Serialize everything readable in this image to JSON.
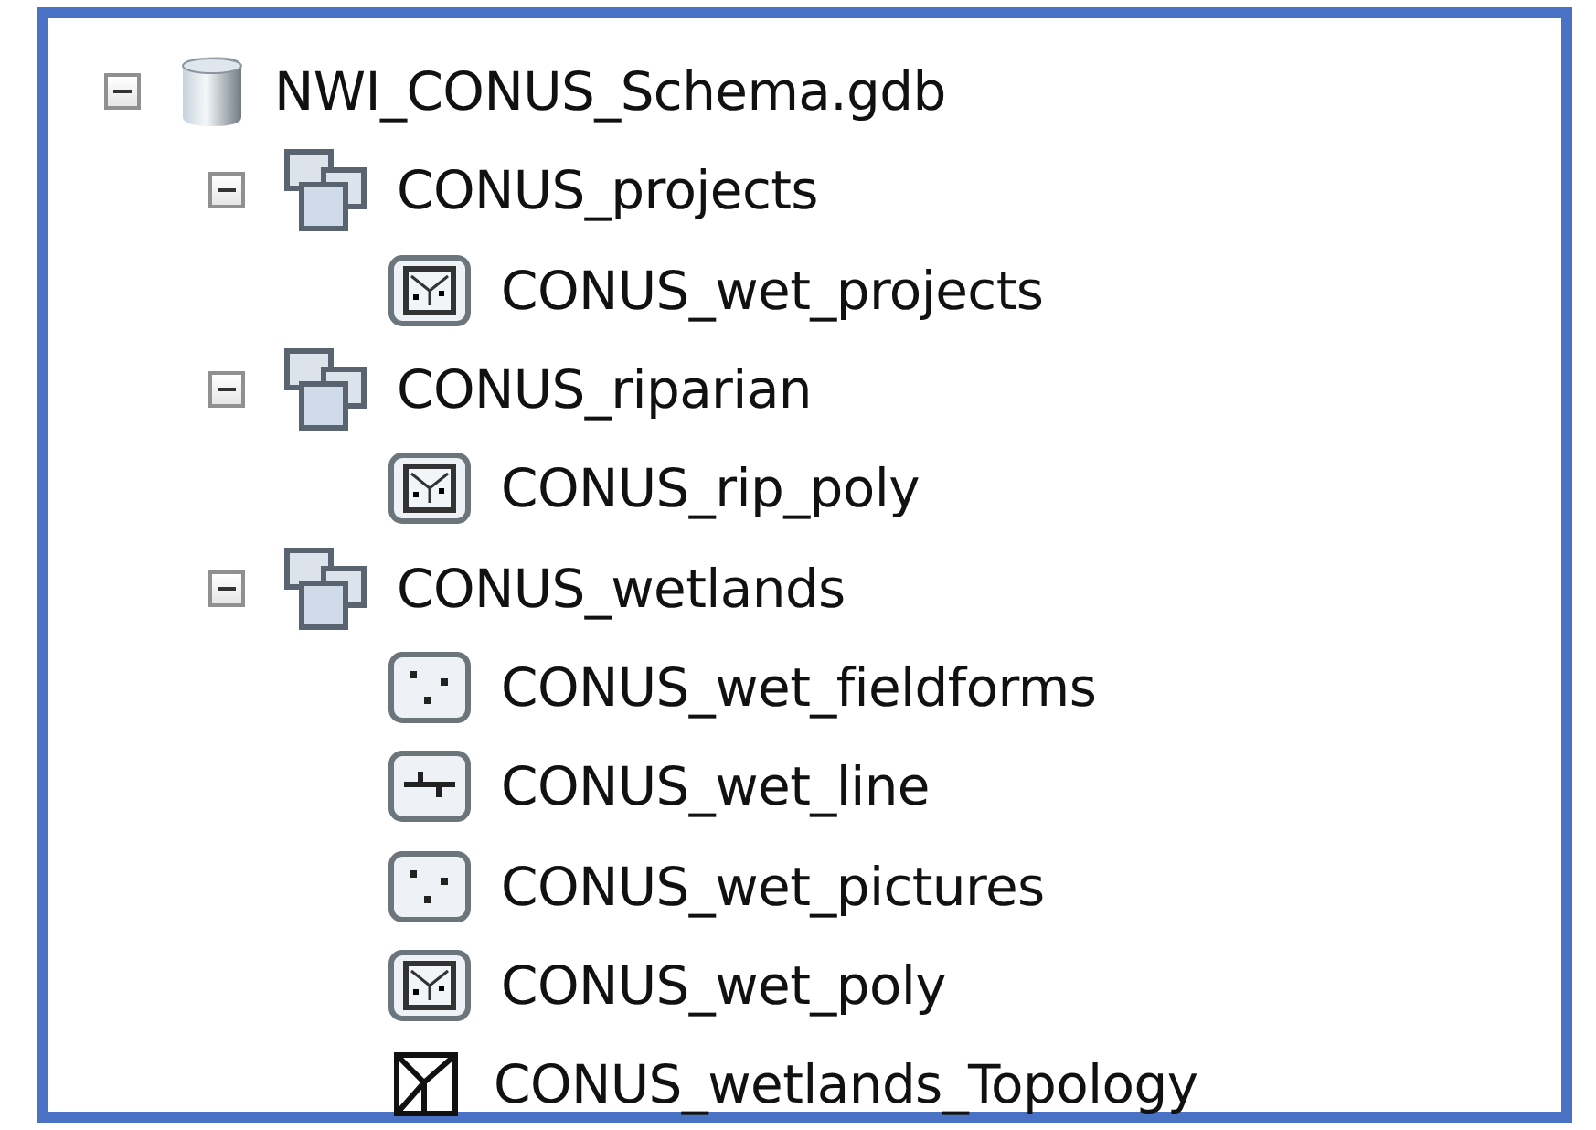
{
  "tree": [
    {
      "label": "NWI_CONUS_Schema.gdb",
      "kind": "database",
      "expanded": true,
      "children": [
        {
          "label": "CONUS_projects",
          "kind": "dataset",
          "expanded": true,
          "children": [
            {
              "label": "CONUS_wet_projects",
              "kind": "polygon"
            }
          ]
        },
        {
          "label": "CONUS_riparian",
          "kind": "dataset",
          "expanded": true,
          "children": [
            {
              "label": "CONUS_rip_poly",
              "kind": "polygon"
            }
          ]
        },
        {
          "label": "CONUS_wetlands",
          "kind": "dataset",
          "expanded": true,
          "children": [
            {
              "label": "CONUS_wet_fieldforms",
              "kind": "point"
            },
            {
              "label": "CONUS_wet_line",
              "kind": "line"
            },
            {
              "label": "CONUS_wet_pictures",
              "kind": "point"
            },
            {
              "label": "CONUS_wet_poly",
              "kind": "polygon"
            },
            {
              "label": "CONUS_wetlands_Topology",
              "kind": "topology"
            }
          ]
        }
      ]
    }
  ]
}
